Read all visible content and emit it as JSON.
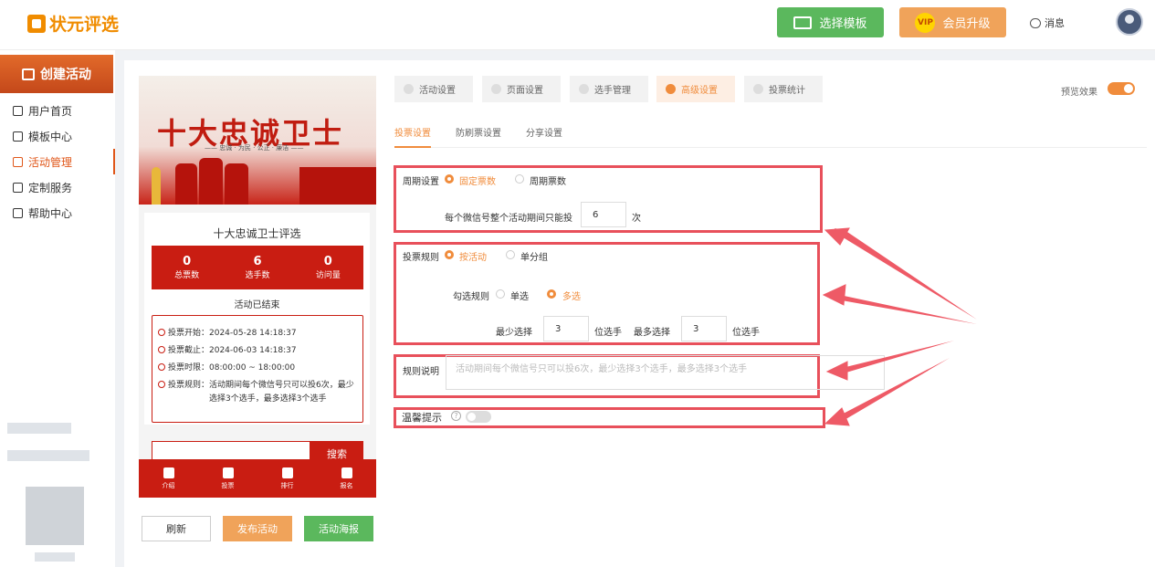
{
  "app": {
    "logo_text": "状元评选"
  },
  "header": {
    "template_button": "选择模板",
    "vip_badge": "VIP",
    "vip_button": "会员升级",
    "messages": "消息"
  },
  "sidebar": {
    "create_button": "创建活动",
    "items": [
      {
        "label": "用户首页",
        "icon": "home-icon",
        "active": false
      },
      {
        "label": "模板中心",
        "icon": "template-icon",
        "active": false
      },
      {
        "label": "活动管理",
        "icon": "activity-icon",
        "active": true
      },
      {
        "label": "定制服务",
        "icon": "custom-icon",
        "active": false
      },
      {
        "label": "帮助中心",
        "icon": "help-icon",
        "active": false
      }
    ]
  },
  "preview": {
    "banner_title": "十大忠诚卫士",
    "banner_subtitle": "—— 忠诚 · 为民 · 公正 · 廉洁 ——",
    "activity_title": "十大忠诚卫士评选",
    "stats": [
      {
        "value": "0",
        "label": "总票数"
      },
      {
        "value": "6",
        "label": "选手数"
      },
      {
        "value": "0",
        "label": "访问量"
      }
    ],
    "status": "活动已结束",
    "details": {
      "start": "投票开始：2024-05-28 14:18:37",
      "end": "投票截止：2024-06-03 14:18:37",
      "hours": "投票时限：08:00:00 ~ 18:00:00",
      "rule_line1": "投票规则：活动期间每个微信号只可以投6次，最少",
      "rule_line2": "选择3个选手，最多选择3个选手"
    },
    "search_button": "搜索",
    "tabs": [
      {
        "label": "介绍",
        "icon": "intro-icon"
      },
      {
        "label": "投票",
        "icon": "vote-home-icon"
      },
      {
        "label": "排行",
        "icon": "rank-icon"
      },
      {
        "label": "报名",
        "icon": "signup-icon"
      }
    ]
  },
  "actions": {
    "refresh": "刷新",
    "publish": "发布活动",
    "poster": "活动海报"
  },
  "settings": {
    "tabs": [
      "活动设置",
      "页面设置",
      "选手管理",
      "高级设置",
      "投票统计"
    ],
    "active_tab": "高级设置",
    "preview_label": "预览效果",
    "subtabs": [
      "投票设置",
      "防刷票设置",
      "分享设置"
    ],
    "active_subtab": "投票设置",
    "cycle": {
      "label": "周期设置",
      "option_fixed": "固定票数",
      "option_period": "周期票数",
      "selected": "固定票数",
      "limit_label": "每个微信号整个活动期间只能投",
      "limit_value": "6",
      "limit_unit": "次"
    },
    "rule": {
      "label": "投票规则",
      "option_activity": "按活动",
      "option_group": "单分组",
      "selected": "按活动",
      "select_label": "勾选规则",
      "option_single": "单选",
      "option_multi": "多选",
      "select_mode": "多选",
      "min_label": "最少选择",
      "min_value": "3",
      "min_unit": "位选手",
      "max_label": "最多选择",
      "max_value": "3",
      "max_unit": "位选手"
    },
    "description": {
      "label": "规则说明",
      "placeholder": "活动期间每个微信号只可以投6次，最少选择3个选手，最多选择3个选手"
    },
    "tip": {
      "label": "温馨提示",
      "help": "?"
    }
  },
  "colors": {
    "accent": "#f08c3c",
    "highlight": "#e8505b",
    "brand_red": "#c91d12",
    "green": "#5bb85d"
  }
}
